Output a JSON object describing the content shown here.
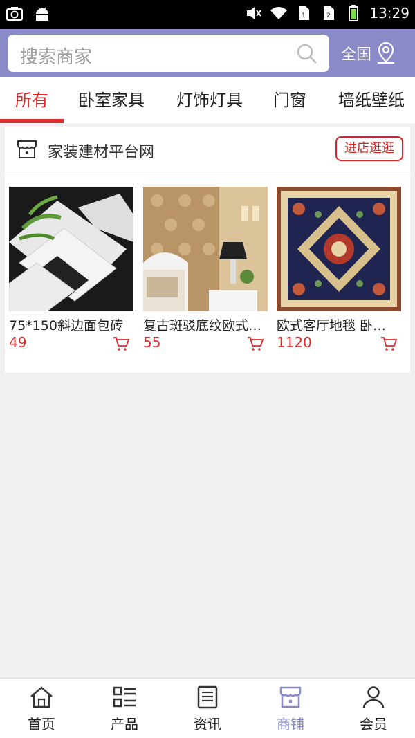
{
  "status_bar": {
    "time": "13:29",
    "left_icons": [
      "screenshot-icon",
      "android-icon"
    ],
    "right_icons": [
      "mute-icon",
      "wifi-icon",
      "sim1-icon",
      "sim2-icon",
      "battery-icon"
    ]
  },
  "header": {
    "search_placeholder": "搜索商家",
    "region_label": "全国",
    "accent_color": "#8a8ac9"
  },
  "tabs": [
    {
      "label": "所有",
      "active": true
    },
    {
      "label": "卧室家具",
      "active": false
    },
    {
      "label": "灯饰灯具",
      "active": false
    },
    {
      "label": "门窗",
      "active": false
    },
    {
      "label": "墙纸壁纸",
      "active": false
    }
  ],
  "shop": {
    "name": "家装建材平台网",
    "enter_label": "进店逛逛",
    "products": [
      {
        "title": "75*150斜边面包砖",
        "price": "49",
        "image": "white-black-tiles-photo"
      },
      {
        "title": "复古斑驳底纹欧式墙纸",
        "price": "55",
        "image": "damask-wallpaper-bedroom-photo"
      },
      {
        "title": "欧式客厅地毯 卧室地毯",
        "price": "1120",
        "image": "persian-carpet-photo"
      }
    ]
  },
  "bottom_nav": [
    {
      "label": "首页",
      "icon": "home-icon",
      "active": false
    },
    {
      "label": "产品",
      "icon": "list-icon",
      "active": false
    },
    {
      "label": "资讯",
      "icon": "news-icon",
      "active": false
    },
    {
      "label": "商铺",
      "icon": "shop-icon",
      "active": true
    },
    {
      "label": "会员",
      "icon": "user-icon",
      "active": false
    }
  ],
  "colors": {
    "accent": "#8a8ac9",
    "red": "#e32a2a"
  }
}
